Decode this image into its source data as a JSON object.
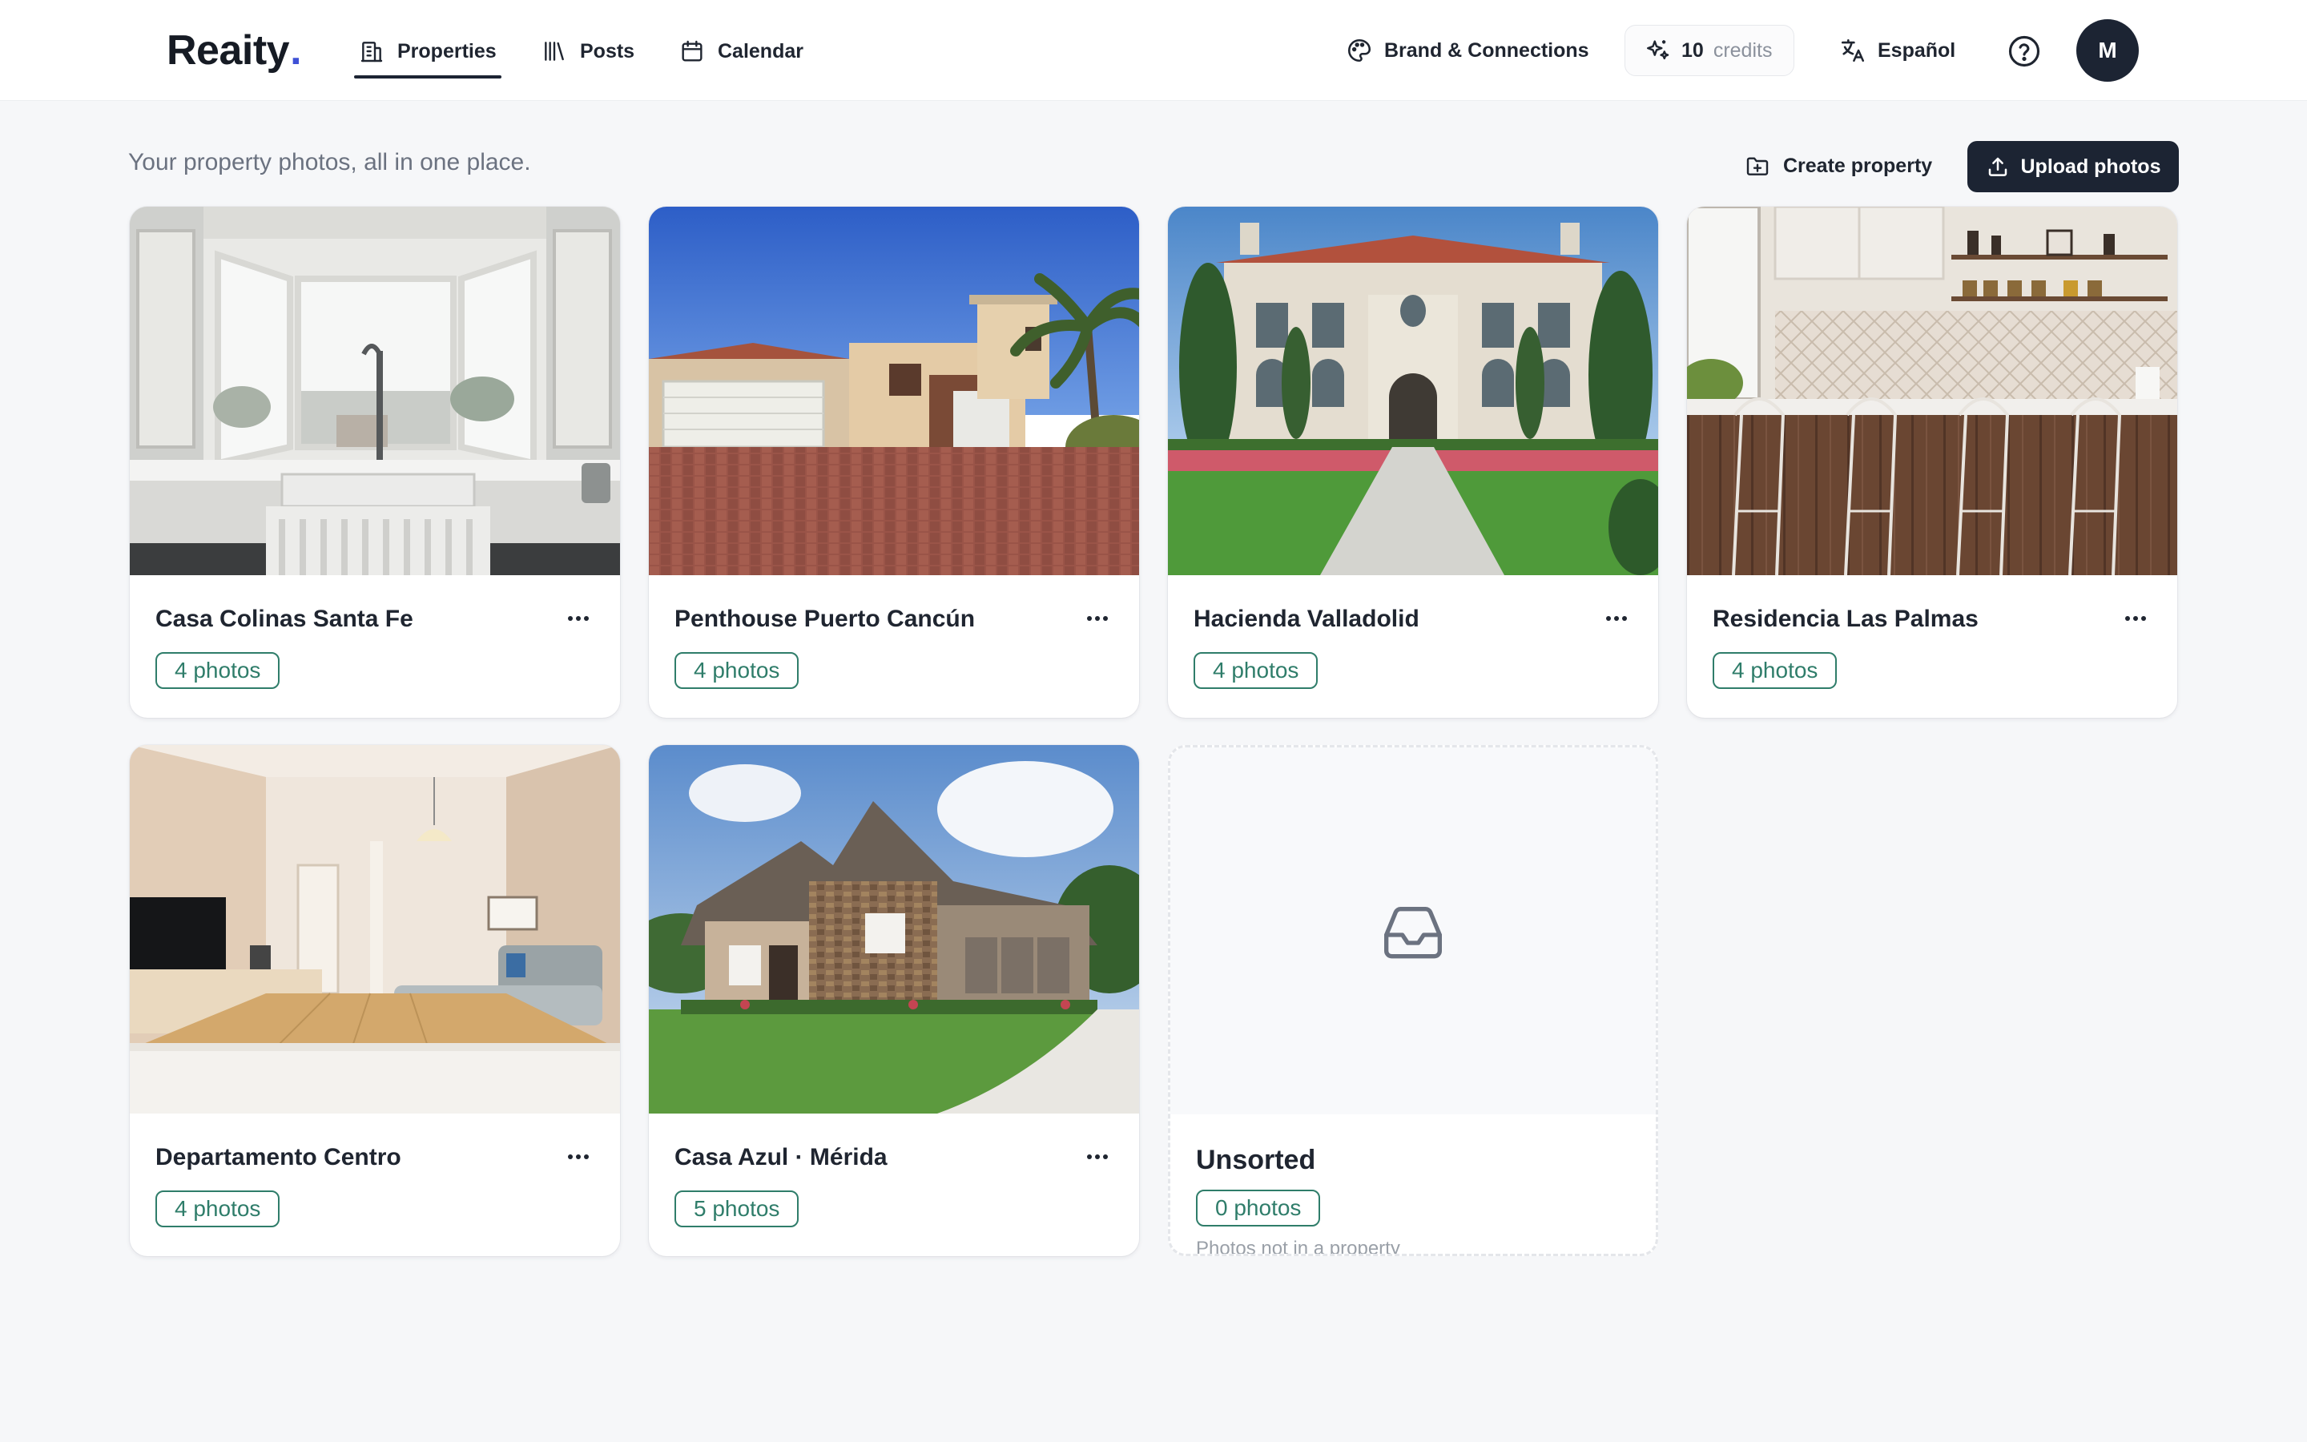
{
  "app": {
    "logo_text": "Reaity",
    "logo_dot": "."
  },
  "nav": {
    "tabs": [
      {
        "label": "Properties",
        "icon": "building-icon",
        "active": true
      },
      {
        "label": "Posts",
        "icon": "library-icon",
        "active": false
      },
      {
        "label": "Calendar",
        "icon": "calendar-icon",
        "active": false
      }
    ],
    "brand_label": "Brand & Connections",
    "credits_count": "10",
    "credits_word": "credits",
    "language_label": "Español",
    "avatar_initial": "M"
  },
  "page": {
    "tagline": "Your property photos, all in one place.",
    "create_label": "Create property",
    "upload_label": "Upload photos"
  },
  "properties": [
    {
      "title": "Casa Colinas Santa Fe",
      "photos": "4 photos",
      "image": "kitchen-window-photo"
    },
    {
      "title": "Penthouse Puerto Cancún",
      "photos": "4 photos",
      "image": "adobe-house-driveway-photo"
    },
    {
      "title": "Hacienda Valladolid",
      "photos": "4 photos",
      "image": "mansion-garden-photo"
    },
    {
      "title": "Residencia Las Palmas",
      "photos": "4 photos",
      "image": "kitchen-bar-stools-photo"
    },
    {
      "title": "Departamento Centro",
      "photos": "4 photos",
      "image": "apartment-interior-photo"
    },
    {
      "title": "Casa Azul · Mérida",
      "photos": "5 photos",
      "image": "stone-house-lawn-photo"
    }
  ],
  "unsorted": {
    "title": "Unsorted",
    "photos": "0 photos",
    "note": "Photos not in a property"
  },
  "colors": {
    "accent_dark": "#1c2433",
    "badge_green": "#2f7d6a",
    "logo_dot": "#3f51d6",
    "page_bg": "#f6f7f9"
  }
}
